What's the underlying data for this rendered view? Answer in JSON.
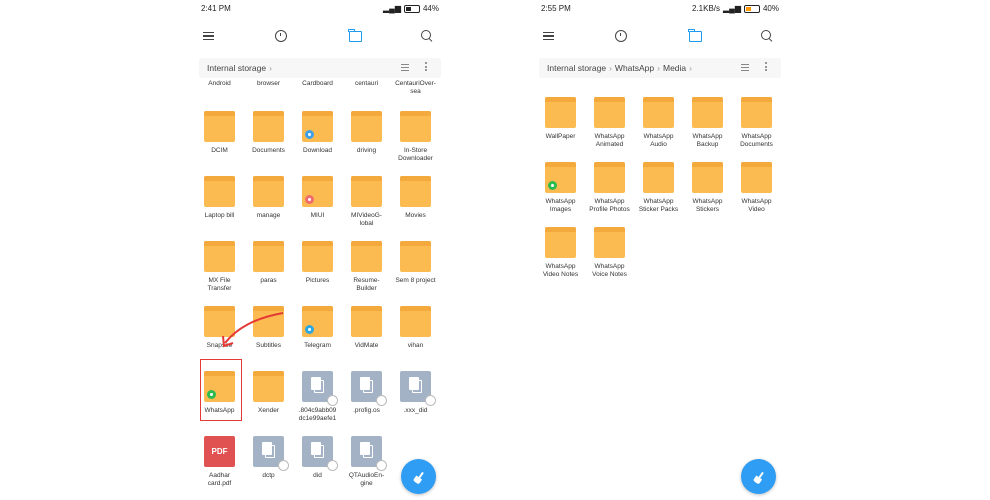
{
  "left_phone": {
    "status": {
      "time": "2:41 PM",
      "battery": "44%",
      "speed": ""
    },
    "breadcrumb": [
      "Internal storage"
    ],
    "top_row_labels": [
      "Android",
      "browser",
      "Cardboard",
      "centauri",
      "CentauriOver-\nsea"
    ],
    "rows": [
      [
        {
          "label": "DCIM",
          "kind": "folder"
        },
        {
          "label": "Documents",
          "kind": "folder"
        },
        {
          "label": "Download",
          "kind": "folder",
          "badge": "blue"
        },
        {
          "label": "driving",
          "kind": "folder"
        },
        {
          "label": "In-Store\nDownloader",
          "kind": "folder"
        }
      ],
      [
        {
          "label": "Laptop bill",
          "kind": "folder"
        },
        {
          "label": "manage",
          "kind": "folder"
        },
        {
          "label": "MIUI",
          "kind": "folder",
          "badge": "pink"
        },
        {
          "label": "MIVideoG-\nlobal",
          "kind": "folder"
        },
        {
          "label": "Movies",
          "kind": "folder"
        }
      ],
      [
        {
          "label": "MX File\nTransfer",
          "kind": "folder"
        },
        {
          "label": "paras",
          "kind": "folder"
        },
        {
          "label": "Pictures",
          "kind": "folder"
        },
        {
          "label": "Resume-\nBuilder",
          "kind": "folder"
        },
        {
          "label": "Sem 8 project",
          "kind": "folder"
        }
      ],
      [
        {
          "label": "Snapsee",
          "kind": "folder"
        },
        {
          "label": "Subtitles",
          "kind": "folder"
        },
        {
          "label": "Telegram",
          "kind": "folder",
          "badge": "tg"
        },
        {
          "label": "VidMate",
          "kind": "folder"
        },
        {
          "label": "vihan",
          "kind": "folder"
        }
      ],
      [
        {
          "label": "WhatsApp",
          "kind": "folder",
          "badge": "green"
        },
        {
          "label": "Xender",
          "kind": "folder"
        },
        {
          "label": ".804c9abb09\ndc1e99aefe1",
          "kind": "file"
        },
        {
          "label": ".profig.os",
          "kind": "file"
        },
        {
          "label": ".xxx_did",
          "kind": "file"
        }
      ],
      [
        {
          "label": "Aadhar\ncard.pdf",
          "kind": "pdf"
        },
        {
          "label": "dctp",
          "kind": "file"
        },
        {
          "label": "did",
          "kind": "file"
        },
        {
          "label": "QTAudioEn-\ngine",
          "kind": "file"
        }
      ]
    ],
    "pdf_text": "PDF"
  },
  "right_phone": {
    "status": {
      "time": "2:55 PM",
      "battery": "40%",
      "speed": "2.1KB/s"
    },
    "breadcrumb": [
      "Internal storage",
      "WhatsApp",
      "Media"
    ],
    "rows": [
      [
        {
          "label": "WallPaper",
          "kind": "folder"
        },
        {
          "label": "WhatsApp\nAnimated",
          "kind": "folder"
        },
        {
          "label": "WhatsApp\nAudio",
          "kind": "folder"
        },
        {
          "label": "WhatsApp\nBackup",
          "kind": "folder"
        },
        {
          "label": "WhatsApp\nDocuments",
          "kind": "folder"
        }
      ],
      [
        {
          "label": "WhatsApp\nImages",
          "kind": "folder",
          "badge": "green"
        },
        {
          "label": "WhatsApp\nProfile Photos",
          "kind": "folder"
        },
        {
          "label": "WhatsApp\nSticker Packs",
          "kind": "folder"
        },
        {
          "label": "WhatsApp\nStickers",
          "kind": "folder"
        },
        {
          "label": "WhatsApp\nVideo",
          "kind": "folder"
        }
      ],
      [
        {
          "label": "WhatsApp\nVideo Notes",
          "kind": "folder"
        },
        {
          "label": "WhatsApp\nVoice Notes",
          "kind": "folder"
        }
      ]
    ]
  },
  "colors": {
    "accent": "#2f9df4",
    "folder": "#fbbb50",
    "highlight": "#e53935"
  },
  "icons": [
    "menu-icon",
    "clock-icon",
    "folder-icon",
    "search-icon",
    "list-view-icon",
    "more-icon",
    "clean-icon"
  ]
}
